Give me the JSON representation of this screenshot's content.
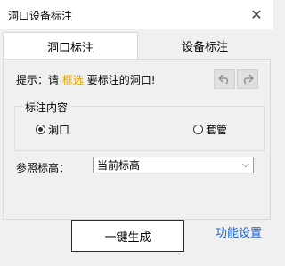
{
  "window": {
    "title": "洞口设备标注",
    "close_glyph": "✕"
  },
  "tabs": [
    {
      "label": "洞口标注",
      "active": true
    },
    {
      "label": "设备标注",
      "active": false
    }
  ],
  "hint": {
    "prefix": "提示：请",
    "highlight": "框选",
    "suffix": "要标注的洞口!",
    "highlight_color": "#e8a000"
  },
  "nav": {
    "back_icon": "undo-arrow-icon",
    "forward_icon": "redo-arrow-icon"
  },
  "content_group": {
    "label": "标注内容",
    "options": [
      {
        "label": "洞口",
        "checked": true
      },
      {
        "label": "套管",
        "checked": false
      }
    ]
  },
  "reference": {
    "label": "参照标高：",
    "value": "当前标高"
  },
  "actions": {
    "generate_label": "一键生成",
    "settings_label": "功能设置",
    "settings_color": "#1b5fd6"
  }
}
